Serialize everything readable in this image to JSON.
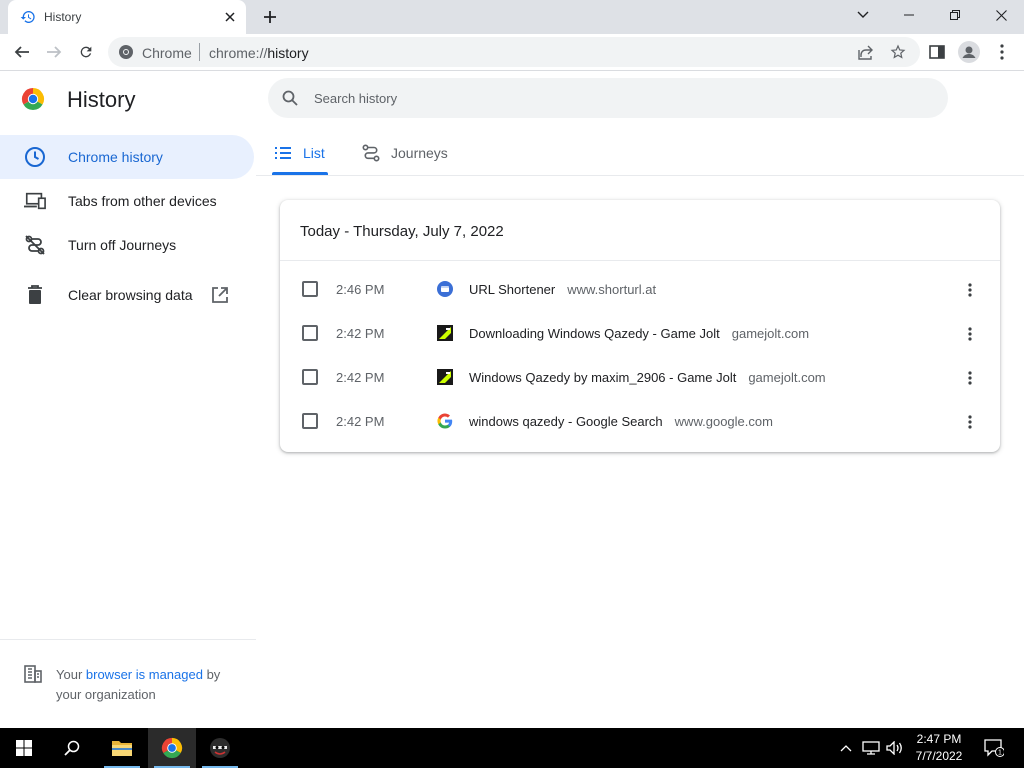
{
  "browser": {
    "tab_title": "History",
    "omnibox_site": "Chrome",
    "omnibox_url_scheme": "chrome://",
    "omnibox_url_host": "history"
  },
  "page": {
    "title": "History",
    "search_placeholder": "Search history"
  },
  "sidebar": {
    "items": [
      {
        "label": "Chrome history",
        "icon": "clock-icon",
        "active": true
      },
      {
        "label": "Tabs from other devices",
        "icon": "devices-icon"
      },
      {
        "label": "Turn off Journeys",
        "icon": "journeys-off-icon"
      },
      {
        "label": "Clear browsing data",
        "icon": "trash-icon"
      }
    ],
    "managed_prefix": "Your ",
    "managed_link": "browser is managed",
    "managed_suffix": " by your organization"
  },
  "view_tabs": [
    {
      "label": "List",
      "icon": "list-icon",
      "selected": true
    },
    {
      "label": "Journeys",
      "icon": "journeys-icon",
      "selected": false
    }
  ],
  "history": {
    "date_header": "Today - Thursday, July 7, 2022",
    "entries": [
      {
        "time": "2:46 PM",
        "title": "URL Shortener",
        "domain": "www.shorturl.at",
        "favicon": "shorturl-favicon"
      },
      {
        "time": "2:42 PM",
        "title": "Downloading Windows Qazedy - Game Jolt",
        "domain": "gamejolt.com",
        "favicon": "gamejolt-favicon"
      },
      {
        "time": "2:42 PM",
        "title": "Windows Qazedy by maxim_2906 - Game Jolt",
        "domain": "gamejolt.com",
        "favicon": "gamejolt-favicon"
      },
      {
        "time": "2:42 PM",
        "title": "windows qazedy - Google Search",
        "domain": "www.google.com",
        "favicon": "google-favicon"
      }
    ]
  },
  "taskbar": {
    "time": "2:47 PM",
    "date": "7/7/2022",
    "notification_count": "1"
  },
  "colors": {
    "accent": "#1a73e8",
    "active_bg": "#e8f0fe",
    "tabstrip": "#dee1e6"
  }
}
